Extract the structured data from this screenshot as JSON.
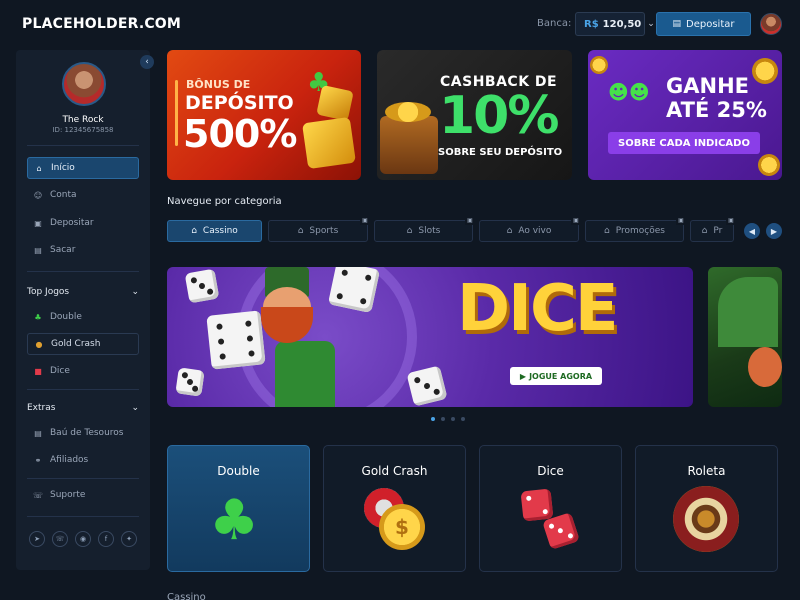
{
  "header": {
    "logo": "PLACEHOLDER.COM",
    "banca_label": "Banca:",
    "balance_currency": "R$",
    "balance_amount": "120,50",
    "deposit_label": "Depositar"
  },
  "profile": {
    "name": "The Rock",
    "id": "ID: 12345675858"
  },
  "sidebar": {
    "main_items": [
      {
        "label": "Início",
        "icon": "home-icon"
      },
      {
        "label": "Conta",
        "icon": "user-icon"
      },
      {
        "label": "Depositar",
        "icon": "deposit-icon"
      },
      {
        "label": "Sacar",
        "icon": "withdraw-icon"
      }
    ],
    "top_games_title": "Top Jogos",
    "top_games": [
      {
        "label": "Double",
        "icon": "clover-icon"
      },
      {
        "label": "Gold Crash",
        "icon": "chip-icon"
      },
      {
        "label": "Dice",
        "icon": "dice-icon"
      }
    ],
    "extras_title": "Extras",
    "extras": [
      {
        "label": "Baú de Tesouros",
        "icon": "chest-icon"
      },
      {
        "label": "Afiliados",
        "icon": "affiliates-icon"
      }
    ],
    "support": {
      "label": "Suporte",
      "icon": "support-icon"
    },
    "socials": [
      "telegram-icon",
      "whatsapp-icon",
      "instagram-icon",
      "facebook-icon",
      "twitter-icon"
    ]
  },
  "promos": {
    "p1_small": "BÔNUS DE",
    "p1_mid": "DEPÓSITO",
    "p1_big": "500%",
    "p2_top": "CASHBACK DE",
    "p2_big": "10%",
    "p2_sub": "SOBRE SEU DEPÓSITO",
    "p3_line1": "GANHE",
    "p3_line2": "ATÉ 25%",
    "p3_btn": "SOBRE CADA INDICADO"
  },
  "categories": {
    "title": "Navegue por categoria",
    "tabs": [
      "Cassino",
      "Sports",
      "Slots",
      "Ao vivo",
      "Promoções",
      "Pr"
    ]
  },
  "hero": {
    "title": "DICE",
    "button": "JOGUE AGORA"
  },
  "carousel": {
    "count": 4,
    "active": 0
  },
  "games": [
    "Double",
    "Gold Crash",
    "Dice",
    "Roleta"
  ],
  "section_below": "Cassino",
  "colors": {
    "background": "#0f1722",
    "accent": "#1a466e",
    "brand_blue": "#4aa3e6",
    "green": "#3ee06a"
  }
}
